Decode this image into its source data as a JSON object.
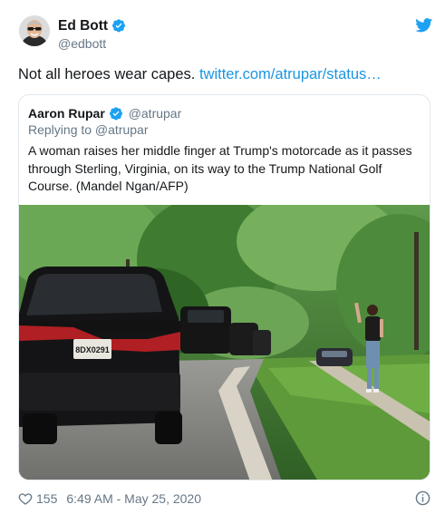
{
  "tweet": {
    "author_name": "Ed Bott",
    "author_handle": "@edbott",
    "text": "Not all heroes wear capes.",
    "link": "twitter.com/atrupar/status…",
    "likes": "155",
    "timestamp": "6:49 AM - May 25, 2020"
  },
  "quoted": {
    "author_name": "Aaron Rupar",
    "author_handle": "@atrupar",
    "replying_to": "Replying to @atrupar",
    "text": "A woman raises her middle finger at Trump's motorcade as it passes through Sterling, Virginia, on its way to the Trump National Golf Course. (Mandel Ngan/AFP)",
    "plate": "8DX0291"
  },
  "icons": {
    "verified": "verified-badge-icon",
    "logo": "twitter-bird-icon",
    "like": "heart-icon",
    "info": "info-icon"
  },
  "colors": {
    "link": "#1b95e0",
    "verified": "#1da1f2",
    "muted": "#657786",
    "border": "#e1e8ed"
  }
}
